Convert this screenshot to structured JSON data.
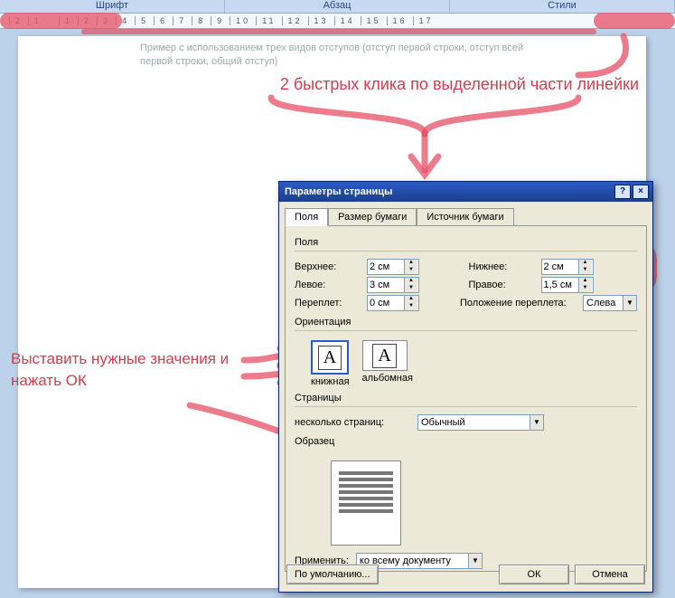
{
  "ribbon": {
    "groups": [
      "Шрифт",
      "Абзац",
      "Стили"
    ]
  },
  "ruler": {
    "ticks": [
      2,
      1,
      "",
      1,
      2,
      3,
      4,
      5,
      6,
      7,
      8,
      9,
      10,
      11,
      12,
      13,
      14,
      15,
      16,
      17
    ]
  },
  "document": {
    "line1": "Пример с использованием трех видов отступов (отступ первой строки, отступ всей",
    "line2": "первой строки, общий отступ)"
  },
  "annotations": {
    "tip1": "2 быстрых клика по выделенной части линейки",
    "tip2": "Выставить нужные значения и нажать ОК"
  },
  "dialog": {
    "title": "Параметры страницы",
    "help_icon": "?",
    "close_icon": "×",
    "tabs": {
      "margins": "Поля",
      "paper": "Размер бумаги",
      "source": "Источник бумаги"
    },
    "section_margins": "Поля",
    "top_label": "Верхнее:",
    "top_value": "2 см",
    "bottom_label": "Нижнее:",
    "bottom_value": "2 см",
    "left_label": "Левое:",
    "left_value": "3 см",
    "right_label": "Правое:",
    "right_value": "1,5 см",
    "gutter_label": "Переплет:",
    "gutter_value": "0 см",
    "gutter_pos_label": "Положение переплета:",
    "gutter_pos_value": "Слева",
    "section_orientation": "Ориентация",
    "portrait": "книжная",
    "landscape": "альбомная",
    "orient_glyph": "A",
    "section_pages": "Страницы",
    "multi_label": "несколько страниц:",
    "multi_value": "Обычный",
    "section_preview": "Образец",
    "apply_label": "Применить:",
    "apply_value": "ко всему документу",
    "btn_default": "По умолчанию...",
    "btn_ok": "ОК",
    "btn_cancel": "Отмена"
  }
}
